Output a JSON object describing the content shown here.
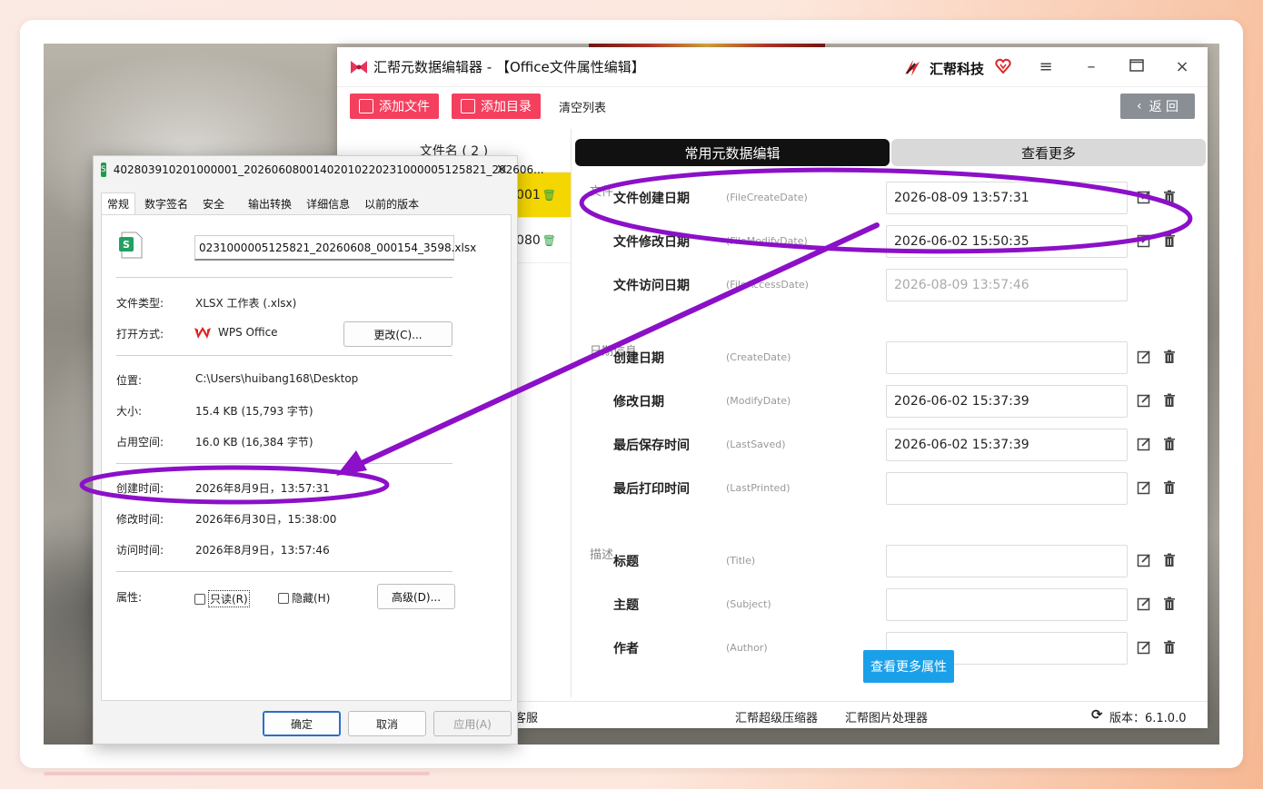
{
  "app": {
    "title": "汇帮元数据编辑器 - 【Office文件属性编辑】",
    "brand": "汇帮科技",
    "toolbar": {
      "add_file": "添加文件",
      "add_dir": "添加目录",
      "clear_list": "清空列表",
      "back": "返 回"
    },
    "file_list": {
      "header": "文件名 ( 2 )",
      "items": [
        {
          "label": "8001",
          "selected": true
        },
        {
          "label": "6080",
          "selected": false
        }
      ]
    },
    "tabs": [
      "常用元数据编辑",
      "查看更多"
    ],
    "sections": {
      "file": "文件",
      "date": "日期信息",
      "desc": "描述"
    },
    "fields": [
      {
        "label": "文件创建日期",
        "key": "(FileCreateDate)",
        "value": "2026-08-09 13:57:31",
        "disabled": false
      },
      {
        "label": "文件修改日期",
        "key": "(FileModifyDate)",
        "value": "2026-06-02 15:50:35",
        "disabled": false
      },
      {
        "label": "文件访问日期",
        "key": "(FileAccessDate)",
        "value": "2026-08-09 13:57:46",
        "disabled": true
      },
      {
        "label": "创建日期",
        "key": "(CreateDate)",
        "value": "",
        "disabled": false
      },
      {
        "label": "修改日期",
        "key": "(ModifyDate)",
        "value": "2026-06-02 15:37:39",
        "disabled": false
      },
      {
        "label": "最后保存时间",
        "key": "(LastSaved)",
        "value": "2026-06-02 15:37:39",
        "disabled": false
      },
      {
        "label": "最后打印时间",
        "key": "(LastPrinted)",
        "value": "",
        "disabled": false
      },
      {
        "label": "标题",
        "key": "(Title)",
        "value": "",
        "disabled": false
      },
      {
        "label": "主题",
        "key": "(Subject)",
        "value": "",
        "disabled": false
      },
      {
        "label": "作者",
        "key": "(Author)",
        "value": "",
        "disabled": false
      }
    ],
    "more_props": "查看更多属性",
    "status": {
      "left": "客服",
      "compress": "汇帮超级压缩器",
      "image": "汇帮图片处理器",
      "version": "版本：6.1.0.0"
    }
  },
  "dialog": {
    "title": "402803910201000001_20260608001402010220231000005125821_202606...",
    "tabs": [
      "常规",
      "数字签名",
      "安全",
      "输出转换",
      "详细信息",
      "以前的版本"
    ],
    "filename": "0231000005125821_20260608_000154_3598.xlsx",
    "rows": {
      "type_label": "文件类型:",
      "type_value": "XLSX 工作表 (.xlsx)",
      "open_label": "打开方式:",
      "open_value": "WPS Office",
      "change_btn": "更改(C)...",
      "loc_label": "位置:",
      "loc_value": "C:\\Users\\huibang168\\Desktop",
      "size_label": "大小:",
      "size_value": "15.4 KB (15,793 字节)",
      "disk_label": "占用空间:",
      "disk_value": "16.0 KB (16,384 字节)",
      "created_label": "创建时间:",
      "created_value": "2026年8月9日，13:57:31",
      "modified_label": "修改时间:",
      "modified_value": "2026年6月30日，15:38:00",
      "accessed_label": "访问时间:",
      "accessed_value": "2026年8月9日，13:57:46",
      "attr_label": "属性:",
      "readonly": "只读(R)",
      "hidden": "隐藏(H)",
      "advanced": "高级(D)..."
    },
    "buttons": {
      "ok": "确定",
      "cancel": "取消",
      "apply": "应用(A)"
    }
  },
  "colors": {
    "accent": "#f43f5e",
    "highlight": "#f4d600",
    "annotation": "#8b10c8",
    "info_btn": "#1aa0e8"
  }
}
